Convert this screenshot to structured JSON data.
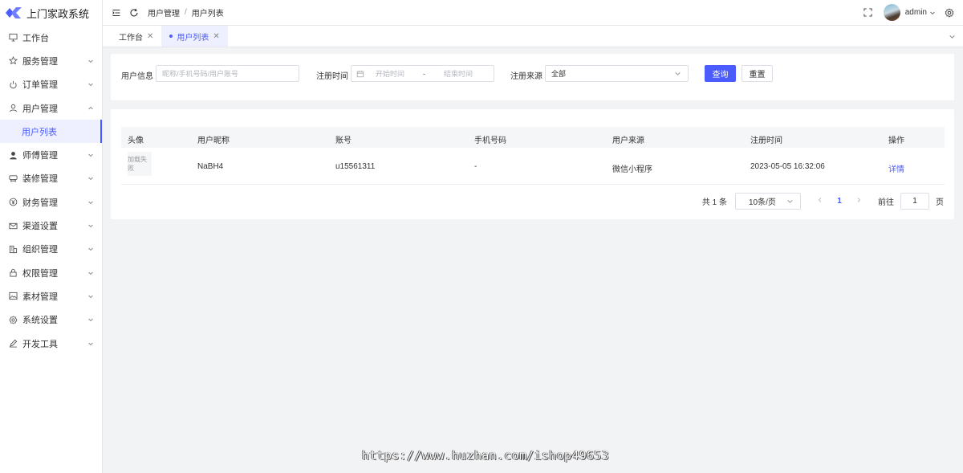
{
  "app": {
    "title": "上门家政系统"
  },
  "sidebar": {
    "items": [
      {
        "label": "工作台",
        "icon": "monitor-icon",
        "chevron": false
      },
      {
        "label": "服务管理",
        "icon": "star-icon",
        "chevron": true
      },
      {
        "label": "订单管理",
        "icon": "power-icon",
        "chevron": true
      },
      {
        "label": "用户管理",
        "icon": "user-icon",
        "chevron": true,
        "expanded": true
      },
      {
        "label": "用户列表",
        "icon": "",
        "sub": true,
        "active": true
      },
      {
        "label": "师傅管理",
        "icon": "person-filled-icon",
        "chevron": true
      },
      {
        "label": "装修管理",
        "icon": "cushion-icon",
        "chevron": true
      },
      {
        "label": "财务管理",
        "icon": "money-circle-icon",
        "chevron": true
      },
      {
        "label": "渠道设置",
        "icon": "mail-icon",
        "chevron": true
      },
      {
        "label": "组织管理",
        "icon": "building-icon",
        "chevron": true
      },
      {
        "label": "权限管理",
        "icon": "lock-icon",
        "chevron": true
      },
      {
        "label": "素材管理",
        "icon": "image-icon",
        "chevron": true
      },
      {
        "label": "系统设置",
        "icon": "gear-icon",
        "chevron": true
      },
      {
        "label": "开发工具",
        "icon": "pen-icon",
        "chevron": true
      }
    ]
  },
  "header": {
    "breadcrumb": [
      "用户管理",
      "用户列表"
    ],
    "breadcrumb_sep": "/",
    "user": "admin"
  },
  "tabs": [
    {
      "label": "工作台",
      "active": false
    },
    {
      "label": "用户列表",
      "active": true
    }
  ],
  "filter": {
    "user_info_label": "用户信息",
    "user_info_placeholder": "昵称/手机号码/用户账号",
    "reg_time_label": "注册时间",
    "start_placeholder": "开始时间",
    "range_sep": "-",
    "end_placeholder": "结束时间",
    "source_label": "注册来源",
    "source_value": "全部",
    "query_button": "查询",
    "reset_button": "重置"
  },
  "table": {
    "columns": [
      "头像",
      "用户昵称",
      "账号",
      "手机号码",
      "用户来源",
      "注册时间",
      "操作"
    ],
    "rows": [
      {
        "avatar_text": "加载失败",
        "nickname": "NaBH4",
        "account": "u15561311",
        "phone": "-",
        "source": "微信小程序",
        "reg_time": "2023-05-05 16:32:06",
        "action": "详情"
      }
    ]
  },
  "pagination": {
    "total_text": "共 1 条",
    "page_size": "10条/页",
    "current_page": "1",
    "goto_label": "前往",
    "goto_value": "1",
    "page_suffix": "页"
  },
  "watermark": "https://www.huzhan.com/ishop49653",
  "colors": {
    "accent": "#4a5cff"
  }
}
